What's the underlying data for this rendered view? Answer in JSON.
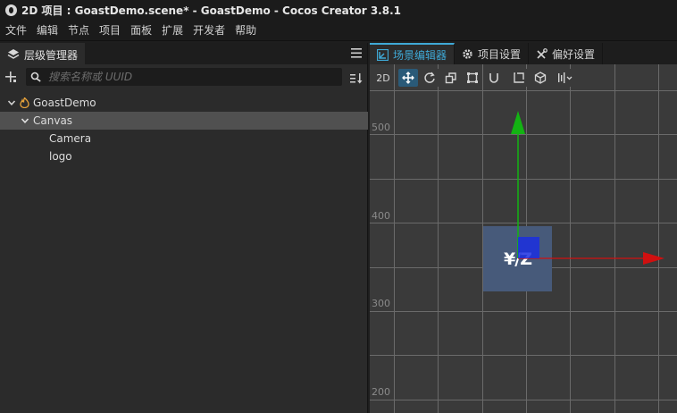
{
  "window": {
    "title": "2D 项目 : GoastDemo.scene* - GoastDemo - Cocos Creator 3.8.1"
  },
  "menubar": {
    "items": [
      "文件",
      "编辑",
      "节点",
      "项目",
      "面板",
      "扩展",
      "开发者",
      "帮助"
    ]
  },
  "hierarchy": {
    "tab_label": "层级管理器",
    "search_placeholder": "搜索名称或 UUID",
    "nodes": [
      {
        "label": "GoastDemo",
        "icon": "fire-icon",
        "expanded": true
      },
      {
        "label": "Canvas",
        "expanded": true,
        "selected": true
      },
      {
        "label": "Camera"
      },
      {
        "label": "logo"
      }
    ]
  },
  "right_tabs": [
    "场景编辑器",
    "项目设置",
    "偏好设置"
  ],
  "scene_toolbar": {
    "mode_2d": "2D"
  },
  "scene": {
    "axis_labels": [
      "500",
      "400",
      "300",
      "200"
    ],
    "logo_text": "¥/Z"
  },
  "colors": {
    "accent": "#3fa9d6",
    "x_axis": "#d01010",
    "y_axis": "#13b313",
    "selected_row": "#505050"
  }
}
